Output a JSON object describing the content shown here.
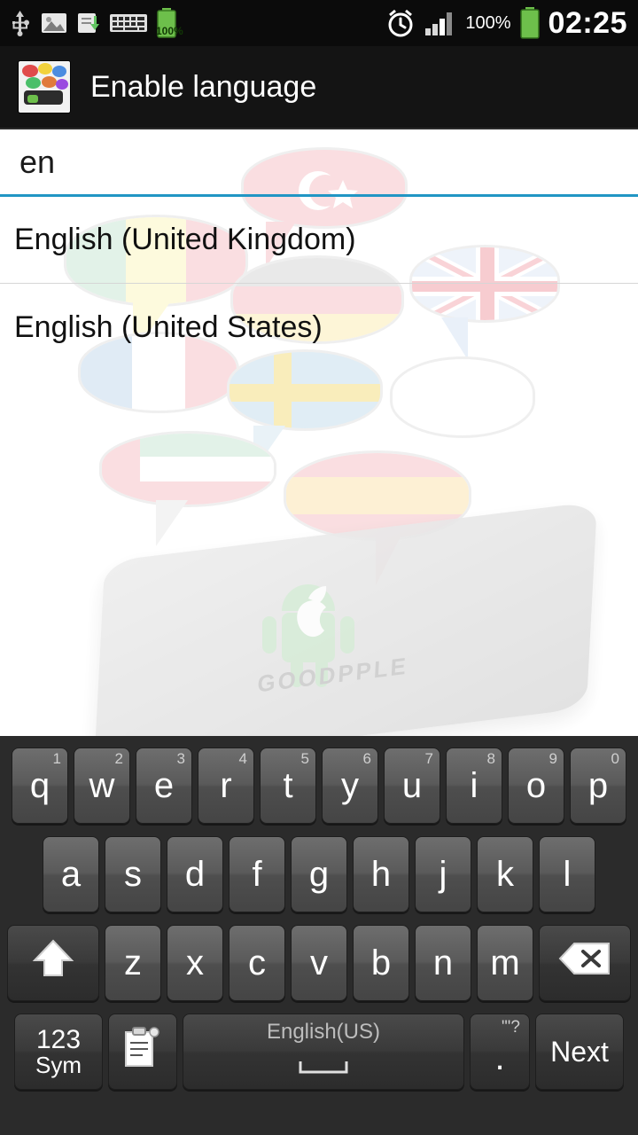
{
  "statusbar": {
    "icons": [
      "usb-icon",
      "image-icon",
      "download-icon",
      "keyboard-icon",
      "battery-charging-icon"
    ],
    "battery_small_label": "100%",
    "right_icons": [
      "alarm-icon",
      "signal-icon"
    ],
    "battery_percent": "100%",
    "clock": "02:25"
  },
  "actionbar": {
    "icon": "app-icon-flags",
    "title": "Enable language"
  },
  "search": {
    "value": "en",
    "placeholder": ""
  },
  "results": [
    {
      "label": "English (United Kingdom)"
    },
    {
      "label": "English (United States)"
    }
  ],
  "artwork": {
    "phone_text": "GOODPPLE"
  },
  "keyboard": {
    "row1": [
      {
        "key": "q",
        "sup": "1"
      },
      {
        "key": "w",
        "sup": "2"
      },
      {
        "key": "e",
        "sup": "3"
      },
      {
        "key": "r",
        "sup": "4"
      },
      {
        "key": "t",
        "sup": "5"
      },
      {
        "key": "y",
        "sup": "6"
      },
      {
        "key": "u",
        "sup": "7"
      },
      {
        "key": "i",
        "sup": "8"
      },
      {
        "key": "o",
        "sup": "9"
      },
      {
        "key": "p",
        "sup": "0"
      }
    ],
    "row2": [
      {
        "key": "a"
      },
      {
        "key": "s"
      },
      {
        "key": "d"
      },
      {
        "key": "f"
      },
      {
        "key": "g"
      },
      {
        "key": "h"
      },
      {
        "key": "j"
      },
      {
        "key": "k"
      },
      {
        "key": "l"
      }
    ],
    "row3": [
      {
        "key": "z"
      },
      {
        "key": "x"
      },
      {
        "key": "c"
      },
      {
        "key": "v"
      },
      {
        "key": "b"
      },
      {
        "key": "n"
      },
      {
        "key": "m"
      }
    ],
    "shift": "shift-icon",
    "delete": "backspace-icon",
    "sym_line1": "123",
    "sym_line2": "Sym",
    "clipboard": "clipboard-icon",
    "space_label": "English(US)",
    "period": ".",
    "period_sup": "\"'?",
    "enter": "Next"
  },
  "colors": {
    "accent": "#2196c4",
    "statusbar_bg": "#0b0b0b",
    "actionbar_bg": "#141414",
    "keyboard_bg": "#2b2b2b",
    "key_face": "#5a5a5a"
  }
}
